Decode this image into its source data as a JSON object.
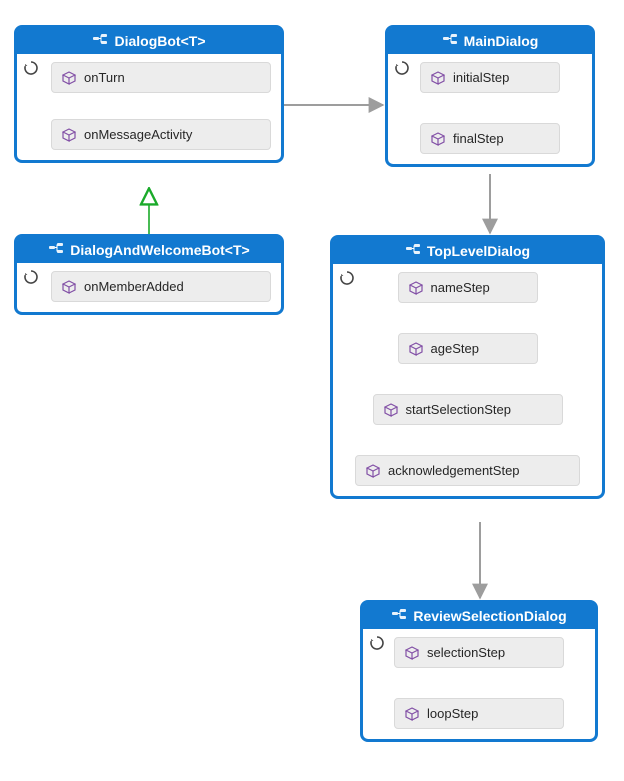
{
  "nodes": {
    "dialogbot": {
      "title": "DialogBot<T>",
      "steps": {
        "onturn": "onTurn",
        "onmessage": "onMessageActivity"
      }
    },
    "maindialog": {
      "title": "MainDialog",
      "steps": {
        "initial": "initialStep",
        "final": "finalStep"
      }
    },
    "welcome": {
      "title": "DialogAndWelcomeBot<T>",
      "steps": {
        "onmemberadded": "onMemberAdded"
      }
    },
    "toplevel": {
      "title": "TopLevelDialog",
      "steps": {
        "name": "nameStep",
        "age": "ageStep",
        "startsel": "startSelectionStep",
        "ack": "acknowledgementStep"
      }
    },
    "review": {
      "title": "ReviewSelectionDialog",
      "steps": {
        "selection": "selectionStep",
        "loop": "loopStep"
      }
    }
  },
  "colors": {
    "border": "#1279d0",
    "step_bg": "#ededed",
    "arrow_solid": "#9d9d9d",
    "arrow_inherit": "#1aaa2a"
  },
  "icons": {
    "class": "class-icon",
    "method": "cube-icon",
    "cycle": "cycle-icon"
  }
}
